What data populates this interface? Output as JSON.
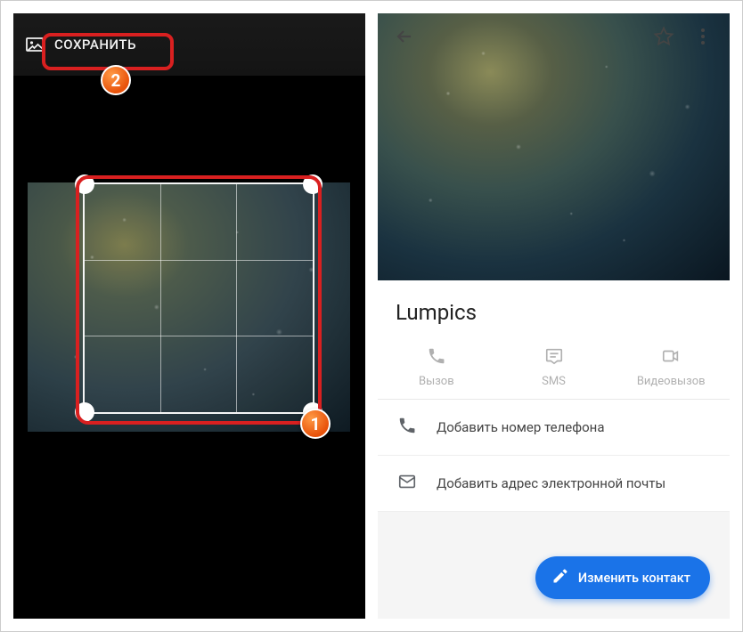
{
  "left": {
    "save_label": "СОХРАНИТЬ",
    "steps": {
      "crop": "1",
      "save": "2"
    }
  },
  "right": {
    "contact_name": "Lumpics",
    "actions": {
      "call": "Вызов",
      "sms": "SMS",
      "video": "Видеовызов"
    },
    "add_phone": "Добавить номер телефона",
    "add_email": "Добавить адрес электронной почты",
    "fab_label": "Изменить контакт"
  }
}
